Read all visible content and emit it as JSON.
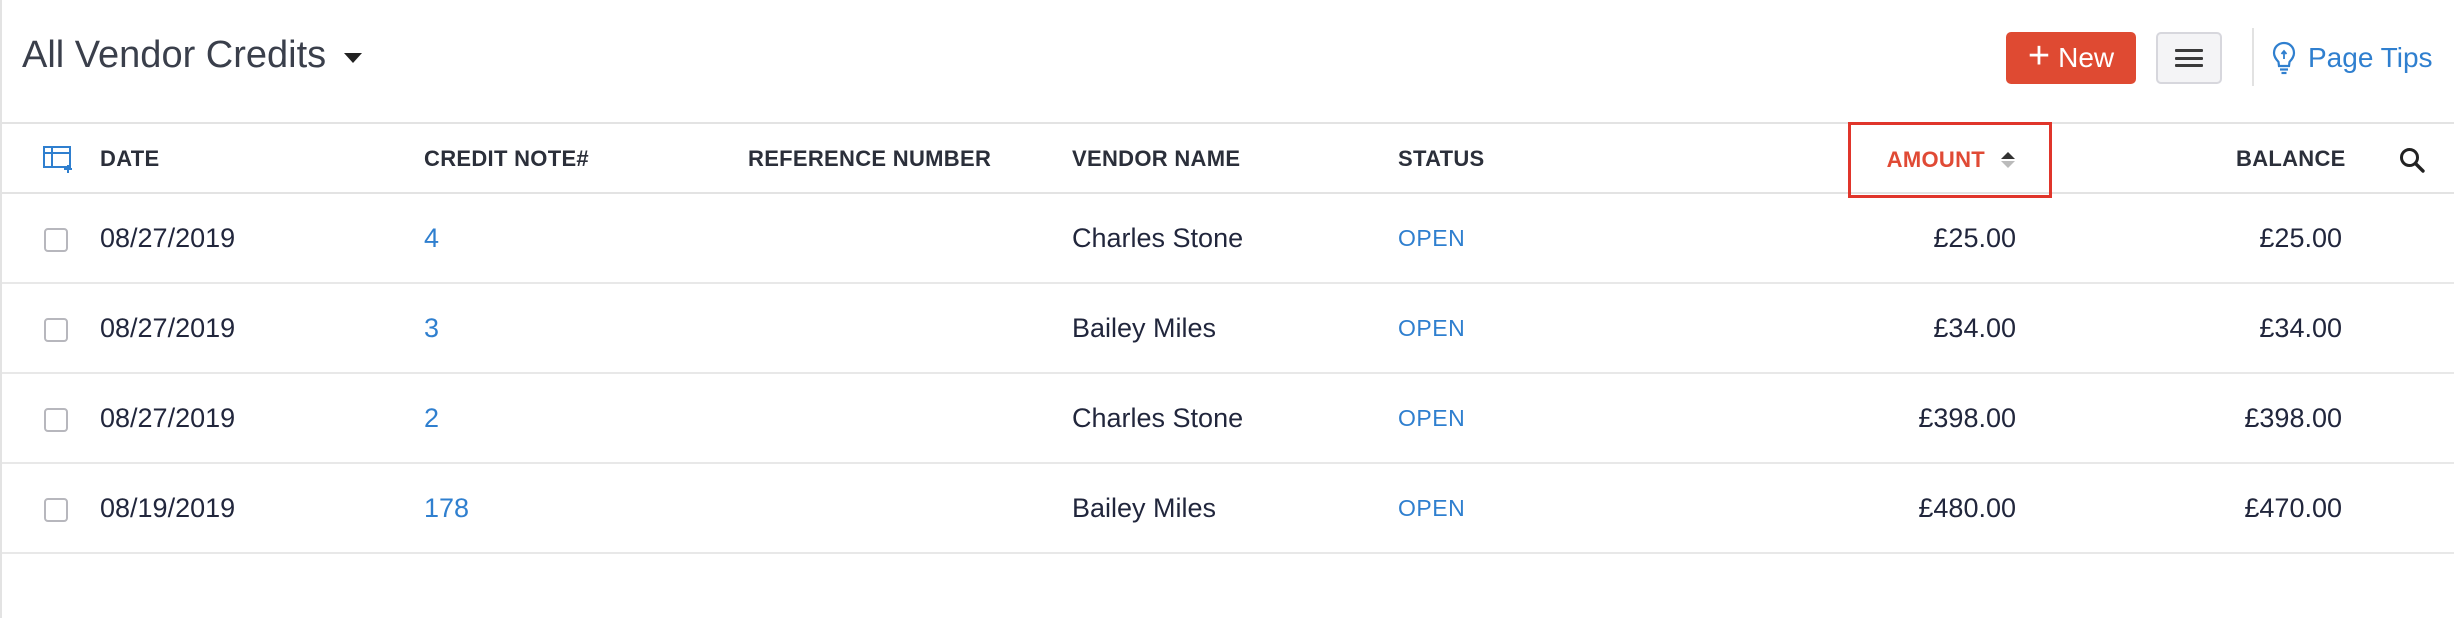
{
  "header": {
    "view_title": "All Vendor Credits",
    "new_button_label": "New",
    "page_tips_label": "Page Tips"
  },
  "table": {
    "columns": {
      "date": "DATE",
      "credit_note": "CREDIT NOTE#",
      "reference": "REFERENCE NUMBER",
      "vendor": "VENDOR NAME",
      "status": "STATUS",
      "amount": "AMOUNT",
      "balance": "BALANCE"
    },
    "sorted_column": "AMOUNT",
    "rows": [
      {
        "date": "08/27/2019",
        "credit_note": "4",
        "reference": "",
        "vendor": "Charles Stone",
        "status": "OPEN",
        "amount": "£25.00",
        "balance": "£25.00"
      },
      {
        "date": "08/27/2019",
        "credit_note": "3",
        "reference": "",
        "vendor": "Bailey Miles",
        "status": "OPEN",
        "amount": "£34.00",
        "balance": "£34.00"
      },
      {
        "date": "08/27/2019",
        "credit_note": "2",
        "reference": "",
        "vendor": "Charles Stone",
        "status": "OPEN",
        "amount": "£398.00",
        "balance": "£398.00"
      },
      {
        "date": "08/19/2019",
        "credit_note": "178",
        "reference": "",
        "vendor": "Bailey Miles",
        "status": "OPEN",
        "amount": "£480.00",
        "balance": "£470.00"
      }
    ]
  },
  "icons": {
    "view_dropdown": "caret-down-icon",
    "new": "plus-icon",
    "menu": "hamburger-icon",
    "tips": "lightbulb-icon",
    "columns": "customize-columns-icon",
    "sort": "sort-icon",
    "search": "search-icon"
  },
  "colors": {
    "primary_button": "#df4a32",
    "link": "#2f7fcf",
    "sorted_header": "#e04a35",
    "highlight_box": "#e0352b"
  }
}
